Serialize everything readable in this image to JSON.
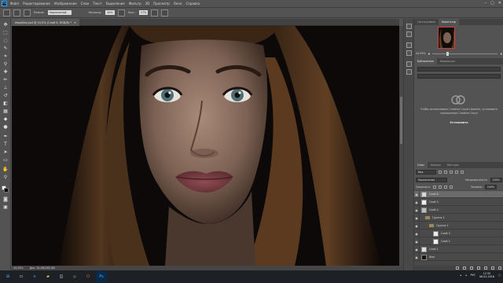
{
  "app": {
    "logo": "Ps"
  },
  "menu": [
    "Файл",
    "Редактирование",
    "Изображение",
    "Слои",
    "Текст",
    "Выделение",
    "Фильтр",
    "3D",
    "Просмотр",
    "Окно",
    "Справка"
  ],
  "window_buttons": [
    "–",
    "▢",
    "✕"
  ],
  "options_bar": {
    "mode_label": "Режим:",
    "mode_value": "Нормальный",
    "opacity_label": "Непрозр.:",
    "opacity_value": "20%",
    "flow_label": "Наж.:",
    "flow_value": "17%"
  },
  "document": {
    "tab_title": "ekpalitra.psd @ 44,5% (Слой 6, RGB/8) *",
    "tab_close": "×",
    "zoom_status": "44,59%",
    "doc_size": "Док: 20,0M/282,0M"
  },
  "right_panels": {
    "top_tabs": [
      "Гистограмма",
      "Навигатор"
    ],
    "top_active": 1,
    "nav_zoom": "44,59%",
    "lib_tabs": [
      "Библиотеки",
      "Коррекция"
    ],
    "lib_active": 0,
    "cc_message": "Чтобы использовать Creative Cloud Libraries, установите приложение Creative Cloud",
    "cc_button": "Установить",
    "layers_tabs": [
      "Слои",
      "Каналы",
      "Контуры"
    ],
    "layers_active": 0,
    "filter_label": "Вид",
    "blend_mode": "Нормальные",
    "opacity_label": "Непрозрачность:",
    "opacity_value": "100%",
    "lock_label": "Закрепить:",
    "fill_label": "Заливка:",
    "fill_value": "100%",
    "layers": [
      {
        "name": "Слой 6",
        "thumb": "#d8d8d8",
        "eye": true,
        "selected": true,
        "indent": 0,
        "folder": false
      },
      {
        "name": "Слой 5",
        "thumb": "#f0f0f0",
        "eye": true,
        "selected": false,
        "indent": 0,
        "folder": false
      },
      {
        "name": "Слой 4",
        "thumb": "#bcbcbc",
        "eye": true,
        "selected": false,
        "indent": 0,
        "folder": false
      },
      {
        "name": "Группа 2",
        "thumb": "",
        "eye": true,
        "selected": false,
        "indent": 1,
        "folder": true
      },
      {
        "name": "Группа 1",
        "thumb": "",
        "eye": true,
        "selected": false,
        "indent": 2,
        "folder": true
      },
      {
        "name": "Слой 3",
        "thumb": "#eaeaea",
        "eye": true,
        "selected": false,
        "indent": 3,
        "folder": false
      },
      {
        "name": "Слой 2",
        "thumb": "#f2f2f2",
        "eye": true,
        "selected": false,
        "indent": 3,
        "folder": false
      },
      {
        "name": "Слой 1",
        "thumb": "#dedede",
        "eye": true,
        "selected": false,
        "indent": 0,
        "folder": false
      },
      {
        "name": "Фон",
        "thumb": "#1a1412",
        "eye": true,
        "selected": false,
        "indent": 0,
        "folder": false
      }
    ]
  },
  "taskbar": {
    "time": "12:35",
    "date": "06.01.2016",
    "lang": "РУС"
  },
  "colors": {
    "ui_bg": "#535353",
    "panel_dark": "#424242",
    "canvas_bg": "#0c0908",
    "nav_frame": "#d43b3b",
    "taskbar": "#1d2024"
  }
}
